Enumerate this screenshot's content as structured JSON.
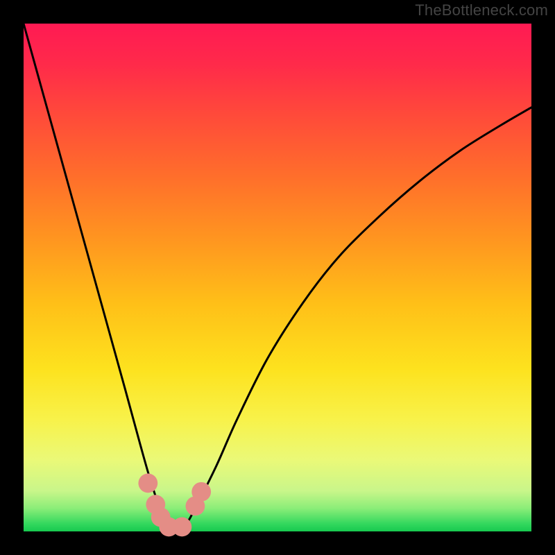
{
  "watermark": "TheBottleneck.com",
  "chart_data": {
    "type": "line",
    "title": "",
    "xlabel": "",
    "ylabel": "",
    "xlim": [
      0,
      100
    ],
    "ylim": [
      0,
      100
    ],
    "x": [
      0,
      5,
      10,
      15,
      20,
      23,
      25,
      27,
      28,
      29,
      30,
      32,
      34,
      38,
      42,
      48,
      55,
      62,
      70,
      78,
      86,
      94,
      100
    ],
    "y": [
      100,
      82,
      64,
      46,
      28,
      17,
      10,
      4,
      1.5,
      0.5,
      0.5,
      1.5,
      5,
      13,
      22,
      34,
      45,
      54,
      62,
      69,
      75,
      80,
      83.5
    ],
    "curve_min_x": 29,
    "markers": [
      {
        "x": 24.5,
        "y": 9.5
      },
      {
        "x": 26.0,
        "y": 5.3
      },
      {
        "x": 27.0,
        "y": 2.8
      },
      {
        "x": 28.6,
        "y": 0.9
      },
      {
        "x": 31.2,
        "y": 0.9
      },
      {
        "x": 33.8,
        "y": 5.0
      },
      {
        "x": 35.0,
        "y": 7.8
      }
    ],
    "marker_color": "#e48d86",
    "marker_radius_pct": 1.9,
    "gradient_stops": [
      {
        "offset": 0.0,
        "color": "#ff1a53"
      },
      {
        "offset": 0.08,
        "color": "#ff2a4a"
      },
      {
        "offset": 0.18,
        "color": "#ff4a3a"
      },
      {
        "offset": 0.3,
        "color": "#ff6e2b"
      },
      {
        "offset": 0.42,
        "color": "#ff9420"
      },
      {
        "offset": 0.55,
        "color": "#ffbf18"
      },
      {
        "offset": 0.68,
        "color": "#fde21e"
      },
      {
        "offset": 0.78,
        "color": "#f8f24a"
      },
      {
        "offset": 0.86,
        "color": "#eaf978"
      },
      {
        "offset": 0.92,
        "color": "#c9f68a"
      },
      {
        "offset": 0.955,
        "color": "#8aed78"
      },
      {
        "offset": 0.985,
        "color": "#33d85e"
      },
      {
        "offset": 1.0,
        "color": "#17c94f"
      }
    ],
    "frame": {
      "outer_w": 800,
      "outer_h": 800,
      "pad_left": 34,
      "pad_right": 34,
      "pad_top": 34,
      "pad_bottom": 34
    }
  }
}
